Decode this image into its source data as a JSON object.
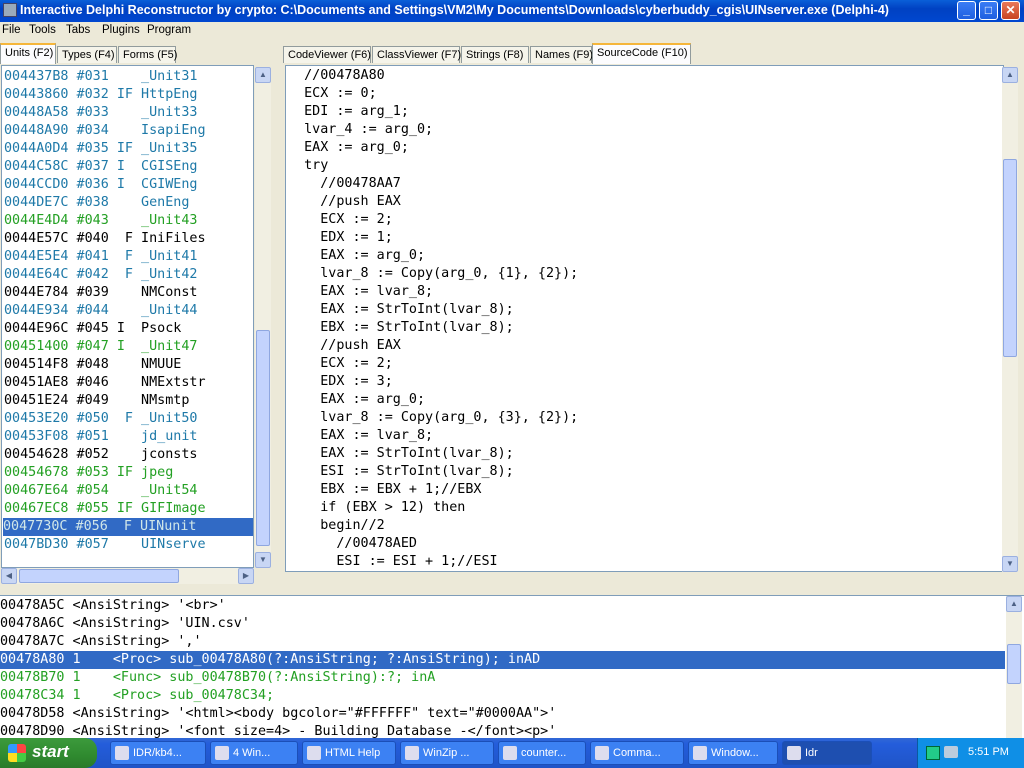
{
  "window": {
    "title": "Interactive Delphi Reconstructor by crypto: C:\\Documents and Settings\\VM2\\My Documents\\Downloads\\cyberbuddy_cgis\\UINserver.exe (Delphi-4)",
    "minimize": "_",
    "maximize": "□",
    "close": "✕"
  },
  "menu": [
    "File",
    "Tools",
    "Tabs",
    "Plugins",
    "Program"
  ],
  "left_tabs": [
    "Units (F2)",
    "Types (F4)",
    "Forms (F5)"
  ],
  "right_tabs": [
    "CodeViewer (F6)",
    "ClassViewer (F7)",
    "Strings (F8)",
    "Names (F9)",
    "SourceCode (F10)"
  ],
  "units": [
    {
      "text": "004437B8 #031    _Unit31",
      "color": "blue"
    },
    {
      "text": "00443860 #032 IF HttpEng",
      "color": "blue"
    },
    {
      "text": "00448A58 #033    _Unit33",
      "color": "blue"
    },
    {
      "text": "00448A90 #034    IsapiEng",
      "color": "blue"
    },
    {
      "text": "0044A0D4 #035 IF _Unit35",
      "color": "blue"
    },
    {
      "text": "0044C58C #037 I  CGISEng",
      "color": "blue"
    },
    {
      "text": "0044CCD0 #036 I  CGIWEng",
      "color": "blue"
    },
    {
      "text": "0044DE7C #038    GenEng",
      "color": "blue"
    },
    {
      "text": "0044E4D4 #043    _Unit43",
      "color": "green"
    },
    {
      "text": "0044E57C #040  F IniFiles",
      "color": "black"
    },
    {
      "text": "0044E5E4 #041  F _Unit41",
      "color": "blue"
    },
    {
      "text": "0044E64C #042  F _Unit42",
      "color": "blue"
    },
    {
      "text": "0044E784 #039    NMConst",
      "color": "black"
    },
    {
      "text": "0044E934 #044    _Unit44",
      "color": "blue"
    },
    {
      "text": "0044E96C #045 I  Psock",
      "color": "black"
    },
    {
      "text": "00451400 #047 I  _Unit47",
      "color": "green"
    },
    {
      "text": "004514F8 #048    NMUUE",
      "color": "black"
    },
    {
      "text": "00451AE8 #046    NMExtstr",
      "color": "black"
    },
    {
      "text": "00451E24 #049    NMsmtp",
      "color": "black"
    },
    {
      "text": "00453E20 #050  F _Unit50",
      "color": "blue"
    },
    {
      "text": "00453F08 #051    jd_unit",
      "color": "blue"
    },
    {
      "text": "00454628 #052    jconsts",
      "color": "black"
    },
    {
      "text": "00454678 #053 IF jpeg",
      "color": "green"
    },
    {
      "text": "00467E64 #054    _Unit54",
      "color": "green"
    },
    {
      "text": "00467EC8 #055 IF GIFImage",
      "color": "green"
    },
    {
      "text": "0047730C #056  F UINunit",
      "color": "selected"
    },
    {
      "text": "0047BD30 #057    UINserve",
      "color": "blue"
    }
  ],
  "source_lines": [
    "  //00478A80",
    "  ECX := 0;",
    "  EDI := arg_1;",
    "  lvar_4 := arg_0;",
    "  EAX := arg_0;",
    "  try",
    "    //00478AA7",
    "    //push EAX",
    "    ECX := 2;",
    "    EDX := 1;",
    "    EAX := arg_0;",
    "    lvar_8 := Copy(arg_0, {1}, {2});",
    "    EAX := lvar_8;",
    "    EAX := StrToInt(lvar_8);",
    "    EBX := StrToInt(lvar_8);",
    "    //push EAX",
    "    ECX := 2;",
    "    EDX := 3;",
    "    EAX := arg_0;",
    "    lvar_8 := Copy(arg_0, {3}, {2});",
    "    EAX := lvar_8;",
    "    EAX := StrToInt(lvar_8);",
    "    ESI := StrToInt(lvar_8);",
    "    EBX := EBX + 1;//EBX",
    "    if (EBX > 12) then",
    "    begin//2",
    "      //00478AED",
    "      ESI := ESI + 1;//ESI"
  ],
  "bottom_lines": [
    {
      "text": "00478A5C <AnsiString> '<br>'",
      "color": "black"
    },
    {
      "text": "00478A6C <AnsiString> 'UIN.csv'",
      "color": "black"
    },
    {
      "text": "00478A7C <AnsiString> ','",
      "color": "black"
    },
    {
      "text": "00478A80 1    <Proc> sub_00478A80(?:AnsiString; ?:AnsiString); inAD",
      "color": "selected"
    },
    {
      "text": "00478B70 1    <Func> sub_00478B70(?:AnsiString):?; inA",
      "color": "green"
    },
    {
      "text": "00478C34 1    <Proc> sub_00478C34;",
      "color": "green"
    },
    {
      "text": "00478D58 <AnsiString> '<html><body bgcolor=\"#FFFFFF\" text=\"#0000AA\">'",
      "color": "black"
    },
    {
      "text": "00478D90 <AnsiString> '<font size=4> - Building Database -</font><p>'",
      "color": "black"
    }
  ],
  "taskbar": {
    "start": "start",
    "tasks": [
      "IDR/kb4...",
      "4 Win...",
      "HTML Help",
      "WinZip ...",
      "counter...",
      "Comma...",
      "Window...",
      "Idr"
    ],
    "clock": "5:51 PM"
  },
  "colors": {
    "blue_text": "#1e79a8",
    "green_text": "#23a023",
    "selection": "#316ac5"
  }
}
